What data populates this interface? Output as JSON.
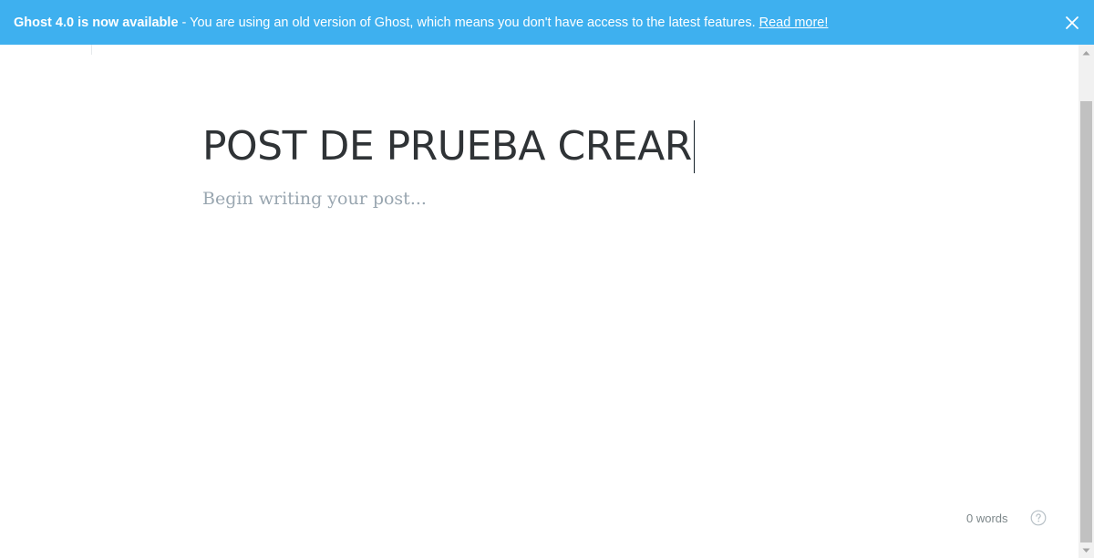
{
  "banner": {
    "headline": "Ghost 4.0 is now available",
    "message": " - You are using an old version of Ghost, which means you don't have access to the latest features. ",
    "link_label": "Read more!",
    "close_icon": "close-icon",
    "background": "#3eb0ef"
  },
  "editor": {
    "title": "POST DE PRUEBA CREAR",
    "body_placeholder": "Begin writing your post..."
  },
  "footer": {
    "word_count": "0 words",
    "help_icon": "question-circle-icon"
  }
}
